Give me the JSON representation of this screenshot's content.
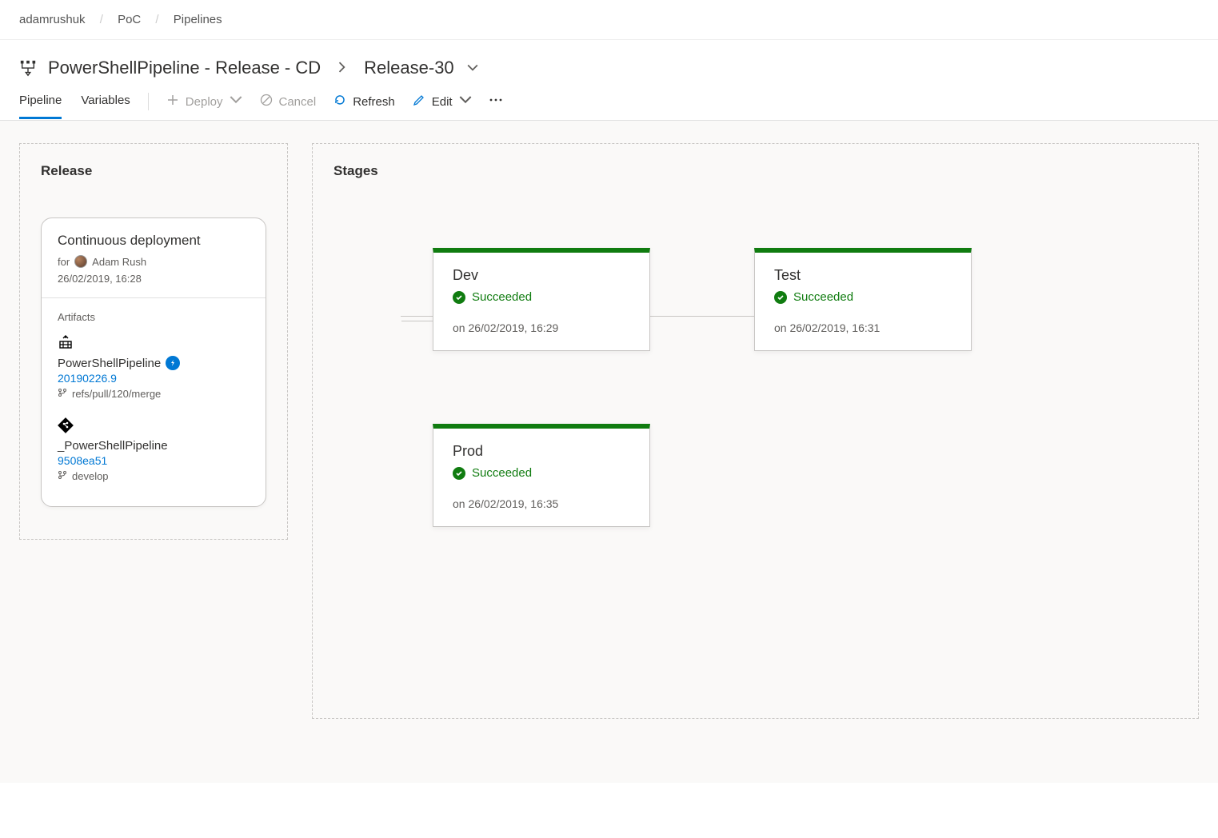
{
  "breadcrumb": {
    "org": "adamrushuk",
    "project": "PoC",
    "section": "Pipelines"
  },
  "header": {
    "title": "PowerShellPipeline - Release - CD",
    "release_name": "Release-30"
  },
  "tabs": {
    "pipeline": "Pipeline",
    "variables": "Variables"
  },
  "toolbar": {
    "deploy": "Deploy",
    "cancel": "Cancel",
    "refresh": "Refresh",
    "edit": "Edit"
  },
  "panels": {
    "release_title": "Release",
    "stages_title": "Stages",
    "artifacts_label": "Artifacts"
  },
  "trigger": {
    "type": "Continuous deployment",
    "for_prefix": "for",
    "user": "Adam Rush",
    "timestamp": "26/02/2019, 16:28"
  },
  "artifacts": [
    {
      "icon": "build",
      "name": "PowerShellPipeline",
      "lightning": true,
      "version": "20190226.9",
      "branch": "refs/pull/120/merge"
    },
    {
      "icon": "git",
      "name": "_PowerShellPipeline",
      "lightning": false,
      "version": "9508ea51",
      "branch": "develop"
    }
  ],
  "stages": [
    {
      "name": "Dev",
      "status": "Succeeded",
      "timestamp": "on 26/02/2019, 16:29"
    },
    {
      "name": "Test",
      "status": "Succeeded",
      "timestamp": "on 26/02/2019, 16:31"
    },
    {
      "name": "Prod",
      "status": "Succeeded",
      "timestamp": "on 26/02/2019, 16:35"
    }
  ],
  "colors": {
    "success": "#107c10",
    "link": "#0078d4"
  }
}
